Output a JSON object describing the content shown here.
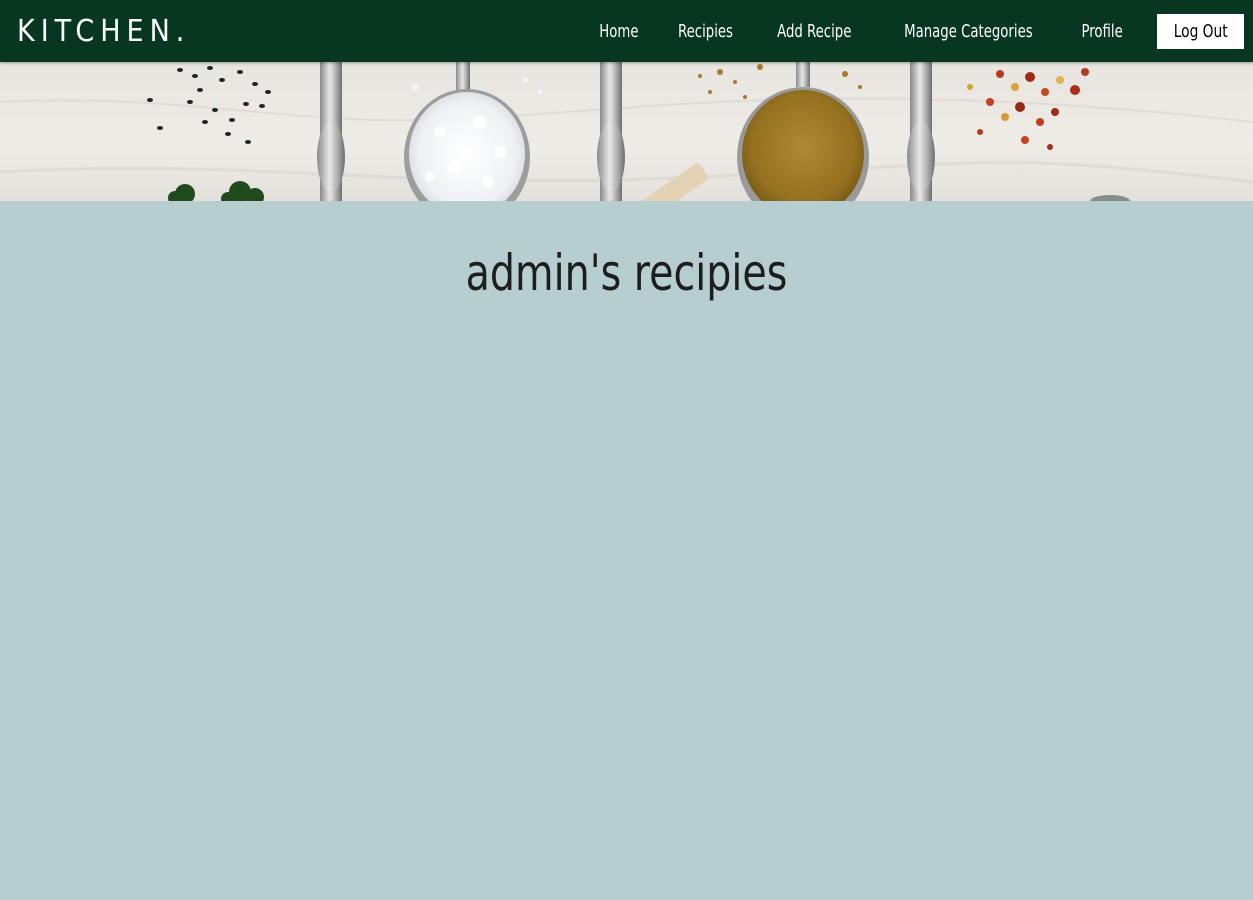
{
  "navbar": {
    "brand": "KITCHEN.",
    "links": [
      {
        "label": "Home"
      },
      {
        "label": "Recipies"
      },
      {
        "label": "Add Recipe"
      },
      {
        "label": "Manage Categories"
      },
      {
        "label": "Profile"
      }
    ],
    "logout_label": "Log Out"
  },
  "hero": {
    "image": "spices-on-spoons-banner"
  },
  "main": {
    "title": "admin's recipies"
  },
  "colors": {
    "navbar_bg": "#073621",
    "page_bg": "#b6cecf",
    "title_text": "#1d1d1d"
  }
}
